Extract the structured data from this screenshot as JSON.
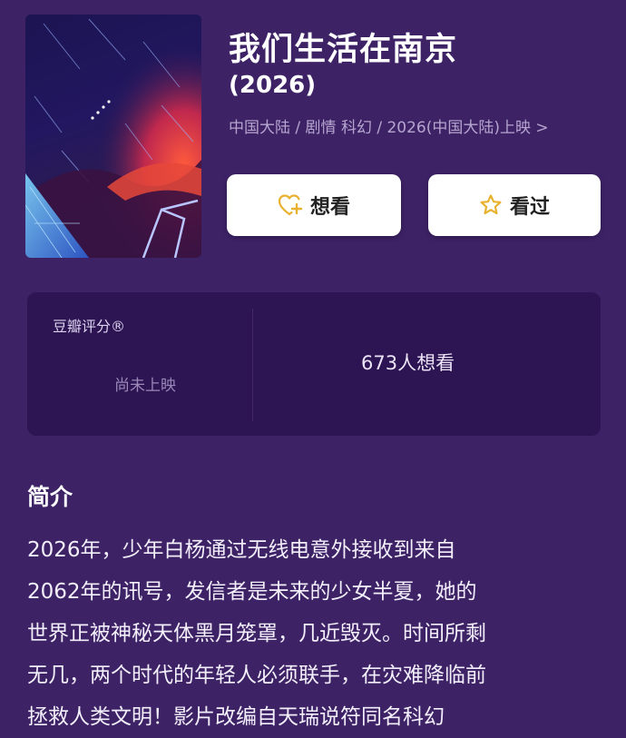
{
  "movie": {
    "title": "我们生活在南京",
    "year": "(2026)",
    "meta": "中国大陆 / 剧情 科幻 / 2026(中国大陆)上映 >"
  },
  "actions": {
    "want_label": "想看",
    "seen_label": "看过",
    "want_icon": "heart-plus-icon",
    "seen_icon": "star-icon"
  },
  "rating": {
    "label": "豆瓣评分®",
    "status": "尚未上映",
    "want_count": "673人想看"
  },
  "intro": {
    "heading": "简介",
    "lines": [
      "2026年，少年白杨通过无线电意外接收到来自",
      "2062年的讯号，发信者是未来的少女半夏，她的",
      "世界正被神秘天体黑月笼罩，几近毁灭。时间所剩",
      "无几，两个时代的年轻人必须联手，在灾难降临前",
      "拯救人类文明！影片改编自天瑞说符同名科幻"
    ]
  },
  "colors": {
    "background": "#3d2266",
    "card": "#2c1552",
    "icon_accent": "#e8b230"
  }
}
